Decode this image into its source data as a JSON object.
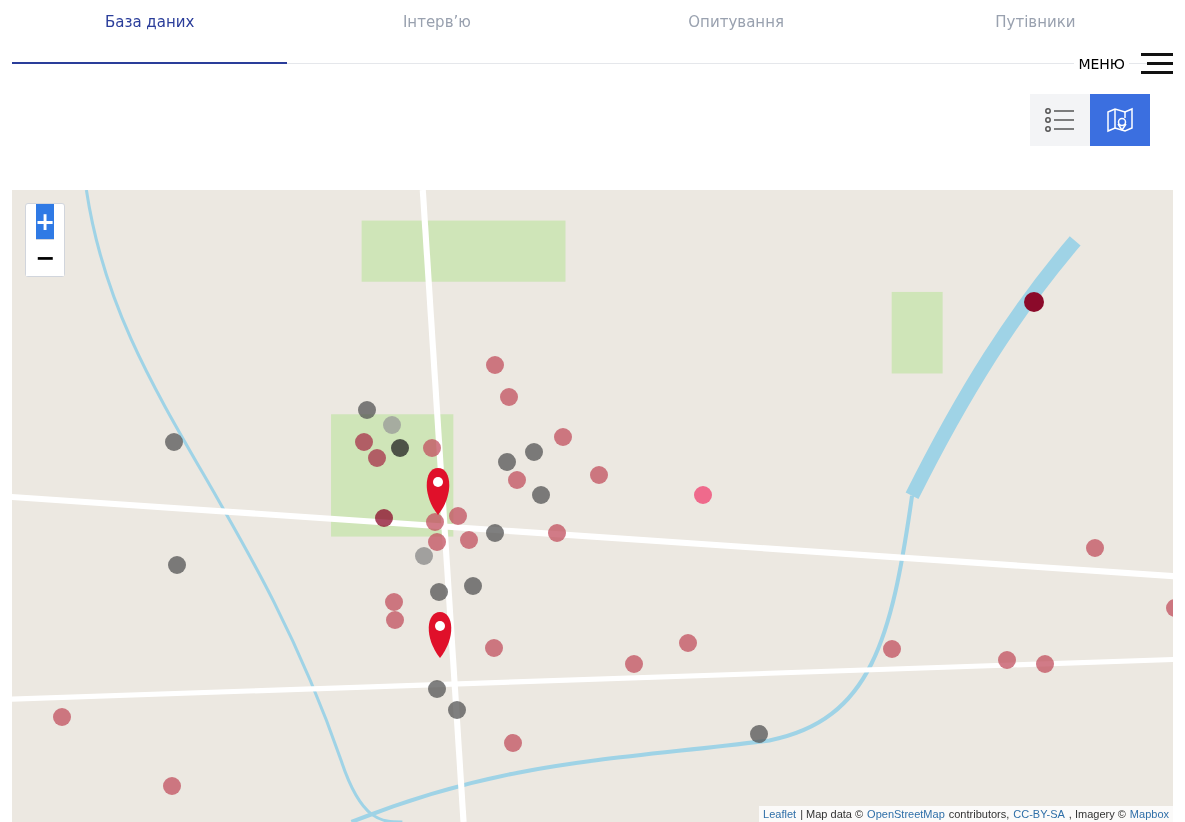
{
  "tabs": [
    {
      "label": "База даних",
      "selected": true
    },
    {
      "label": "Інтерв’ю",
      "selected": false
    },
    {
      "label": "Опитування",
      "selected": false
    },
    {
      "label": "Путівники",
      "selected": false
    }
  ],
  "menu": {
    "label": "МЕНЮ"
  },
  "view_toggle": [
    {
      "kind": "list",
      "selected": false
    },
    {
      "kind": "map",
      "selected": true
    }
  ],
  "map": {
    "zoom_controls": [
      {
        "label": "+",
        "selected": true
      },
      {
        "label": "−",
        "selected": false
      }
    ],
    "attribution": [
      {
        "kind": "link",
        "text": "Leaflet"
      },
      {
        "kind": "text",
        "text": "| Map data ©"
      },
      {
        "kind": "link",
        "text": "OpenStreetMap"
      },
      {
        "kind": "text",
        "text": "contributors,"
      },
      {
        "kind": "link",
        "text": "CC-BY-SA"
      },
      {
        "kind": "text",
        "text": ", Imagery ©"
      },
      {
        "kind": "link",
        "text": "Mapbox"
      }
    ]
  }
}
